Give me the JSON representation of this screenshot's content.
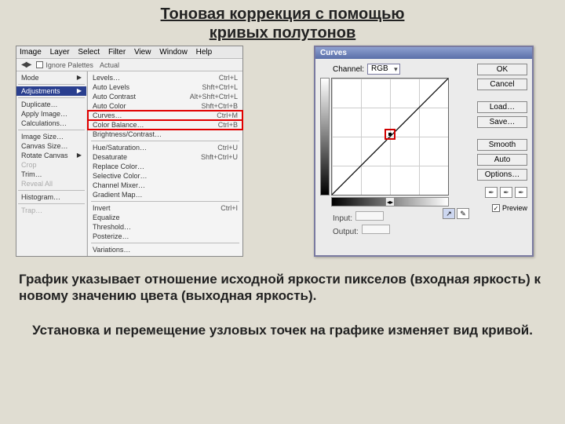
{
  "title_line1": "Тоновая коррекция с помощью",
  "title_line2": "кривых полутонов",
  "menubar": [
    "Image",
    "Layer",
    "Select",
    "Filter",
    "View",
    "Window",
    "Help"
  ],
  "toolbar": {
    "ignore_palettes": "Ignore Palettes",
    "actual": "Actual"
  },
  "image_menu": {
    "mode": "Mode",
    "adjustments": "Adjustments",
    "duplicate": "Duplicate…",
    "apply_image": "Apply Image…",
    "calculations": "Calculations…",
    "image_size": "Image Size…",
    "canvas_size": "Canvas Size…",
    "rotate_canvas": "Rotate Canvas",
    "crop": "Crop",
    "trim": "Trim…",
    "reveal_all": "Reveal All",
    "histogram": "Histogram…",
    "trap": "Trap…"
  },
  "adjust_menu": [
    {
      "label": "Levels…",
      "sc": "Ctrl+L"
    },
    {
      "label": "Auto Levels",
      "sc": "Shft+Ctrl+L"
    },
    {
      "label": "Auto Contrast",
      "sc": "Alt+Shft+Ctrl+L"
    },
    {
      "label": "Auto Color",
      "sc": "Shft+Ctrl+B"
    },
    {
      "label": "Curves…",
      "sc": "Ctrl+M",
      "hl": true
    },
    {
      "label": "Color Balance…",
      "sc": "Ctrl+B",
      "hl": true
    },
    {
      "label": "Brightness/Contrast…",
      "sc": ""
    },
    {
      "sep": true
    },
    {
      "label": "Hue/Saturation…",
      "sc": "Ctrl+U"
    },
    {
      "label": "Desaturate",
      "sc": "Shft+Ctrl+U"
    },
    {
      "label": "Replace Color…",
      "sc": ""
    },
    {
      "label": "Selective Color…",
      "sc": ""
    },
    {
      "label": "Channel Mixer…",
      "sc": ""
    },
    {
      "label": "Gradient Map…",
      "sc": ""
    },
    {
      "sep": true
    },
    {
      "label": "Invert",
      "sc": "Ctrl+I"
    },
    {
      "label": "Equalize",
      "sc": ""
    },
    {
      "label": "Threshold…",
      "sc": ""
    },
    {
      "label": "Posterize…",
      "sc": ""
    },
    {
      "sep": true
    },
    {
      "label": "Variations…",
      "sc": ""
    }
  ],
  "curves": {
    "title": "Curves",
    "channel_label": "Channel:",
    "channel_value": "RGB",
    "input_label": "Input:",
    "output_label": "Output:",
    "buttons": {
      "ok": "OK",
      "cancel": "Cancel",
      "load": "Load…",
      "save": "Save…",
      "smooth": "Smooth",
      "auto": "Auto",
      "options": "Options…"
    },
    "preview": "Preview"
  },
  "para1": "График указывает отношение исходной яркости пикселов (входная яркость) к новому значению цвета (выходная яркость).",
  "para2": "Установка и перемещение узловых точек на графике изменяет вид кривой."
}
